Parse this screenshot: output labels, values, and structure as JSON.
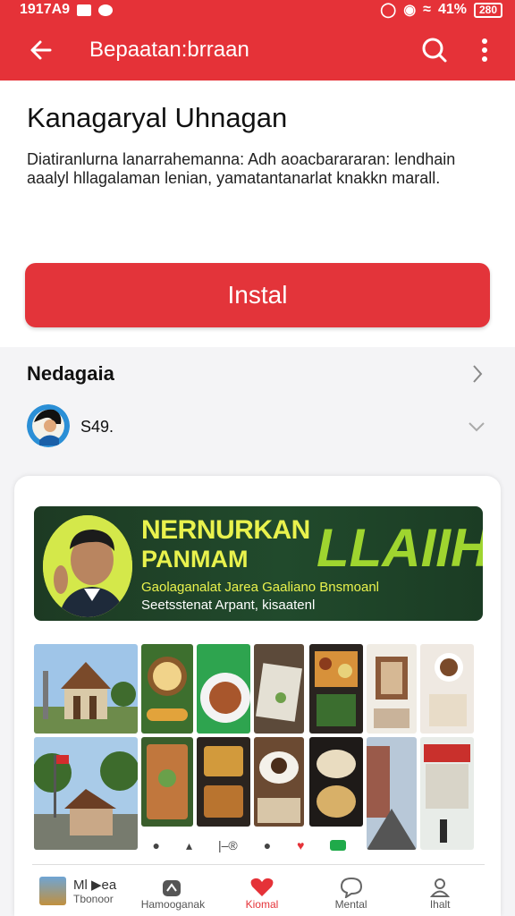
{
  "status_bar": {
    "time": "1917A9",
    "battery": "41%",
    "battery_box": "280"
  },
  "app_bar": {
    "title": "Bepaatan:brraan"
  },
  "app": {
    "name": "Kanagaryal Uhnagan",
    "description": "Diatiranlurna lanarrahemanna: Adh aoacbarararan: lendhain aaalyl hllagalaman lenian, yamatantanarlat knakkn marall.",
    "install_label": "Instal"
  },
  "section": {
    "title": "Nedagaia",
    "rating": "S49."
  },
  "banner": {
    "headline": "NERNURKAN",
    "subheadline": "PANMAM",
    "big_text": "LLAIIH",
    "line1": "Gaolaganalat Jarea  Gaaliano Bnsmoanl",
    "line2": "Seetsstenat Arpant, kisaatenl"
  },
  "media_controls": {
    "label": "|–®"
  },
  "bottom_nav": {
    "items": [
      {
        "top": "Ml ▶ea",
        "label": "Tbonoor"
      },
      {
        "label": "Hamooganak"
      },
      {
        "label": "Kiomal"
      },
      {
        "label": "Mental"
      },
      {
        "label": "Ihalt"
      }
    ]
  },
  "colors": {
    "brand": "#e53238",
    "banner_text": "#e9f24d",
    "banner_big": "#9fd52f",
    "banner_bg": "#1d3a23"
  }
}
